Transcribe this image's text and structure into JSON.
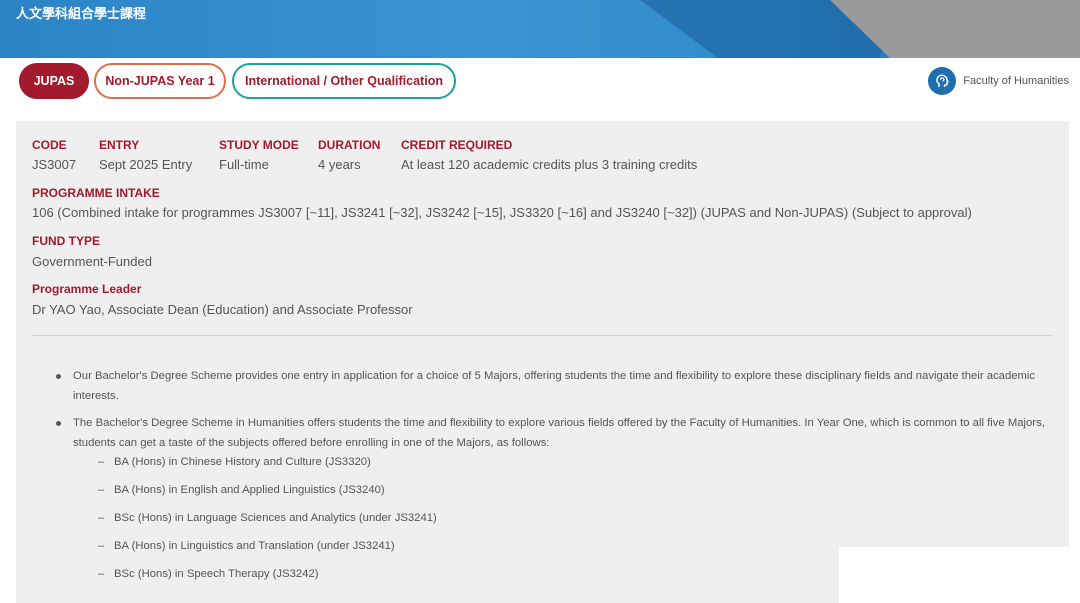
{
  "header": {
    "title": "人文學科組合學士課程"
  },
  "tabs": [
    {
      "label": "JUPAS"
    },
    {
      "label": "Non-JUPAS Year 1"
    },
    {
      "label": "International / Other Qualification"
    }
  ],
  "faculty": {
    "label": "Faculty of Humanities",
    "icon": "head-profile-icon"
  },
  "info": {
    "code_label": "CODE",
    "code_value": "JS3007",
    "entry_label": "ENTRY",
    "entry_value": "Sept 2025 Entry",
    "mode_label": "STUDY MODE",
    "mode_value": "Full-time",
    "duration_label": "DURATION",
    "duration_value": "4 years",
    "credit_label": "CREDIT REQUIRED",
    "credit_value": "At least 120 academic credits plus 3 training credits",
    "intake_label": "PROGRAMME INTAKE",
    "intake_value": "106 (Combined intake for programmes JS3007 [~11], JS3241 [~32], JS3242 [~15], JS3320 [~16] and JS3240 [~32]) (JUPAS and Non-JUPAS) (Subject to approval)",
    "fund_label": "FUND TYPE",
    "fund_value": "Government-Funded",
    "leader_label": "Programme Leader",
    "leader_value": "Dr YAO Yao, Associate Dean (Education) and Associate Professor"
  },
  "bullets": [
    "Our Bachelor's Degree Scheme provides one entry in application for a choice of 5 Majors, offering students the time and flexibility to explore these disciplinary fields and navigate their academic interests.",
    "The Bachelor's Degree Scheme in Humanities offers students the time and flexibility to explore various fields offered by the Faculty of Humanities. In Year One, which is common to all five Majors, students can get a taste of the subjects offered before enrolling in one of the Majors, as follows:"
  ],
  "majors": [
    "BA (Hons) in Chinese History and Culture (JS3320)",
    "BA (Hons) in English and Applied Linguistics (JS3240)",
    "BSc (Hons) in Language Sciences and Analytics (under JS3241)",
    "BA (Hons) in Linguistics and Translation (under JS3241)",
    "BSc (Hons) in Speech Therapy (JS3242)"
  ],
  "colors": {
    "brand_red": "#a3192e",
    "tab_orange": "#d9714e",
    "tab_teal": "#1aa39a",
    "banner_blue": "#2b84c6"
  }
}
